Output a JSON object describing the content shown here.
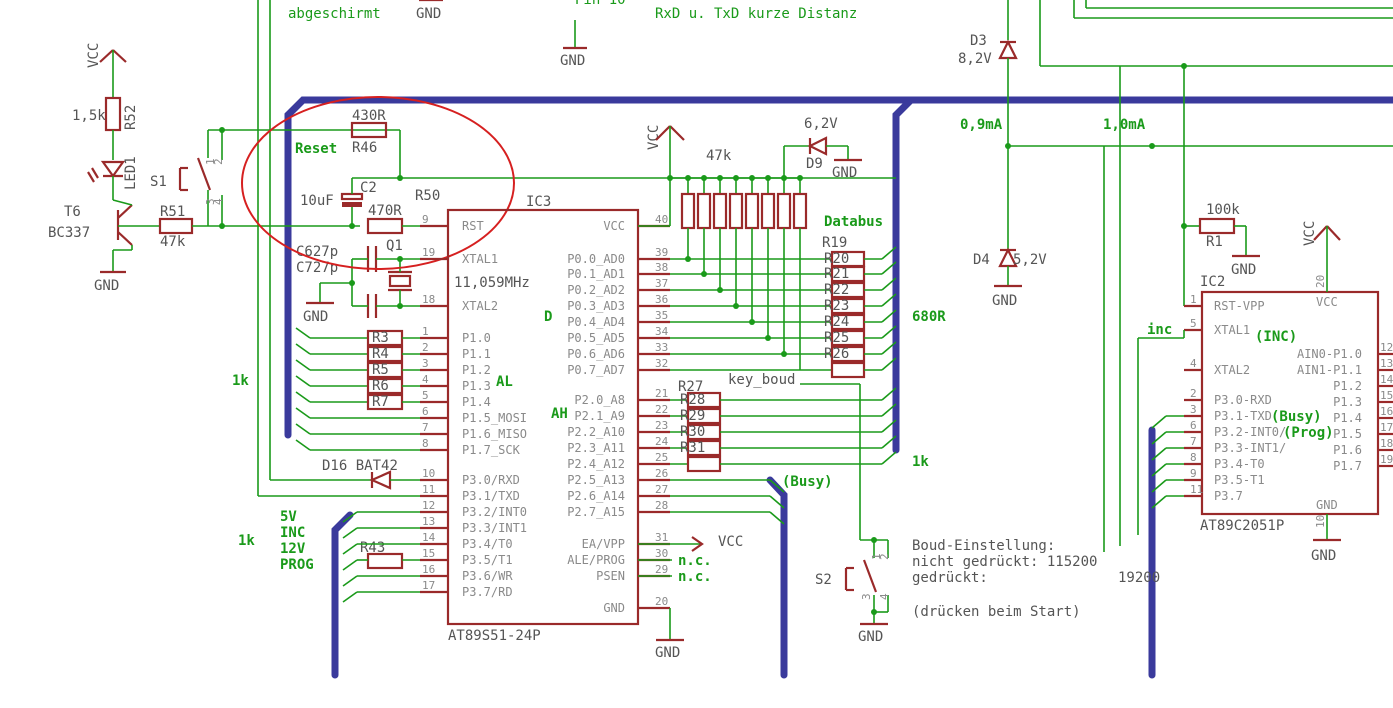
{
  "title_notes": {
    "shielded": "abgeschirmt",
    "rxd_txd": "RxD u. TxD kurze Distanz",
    "pin_top": "Pin 10"
  },
  "power": {
    "vcc": "VCC",
    "gnd": "GND"
  },
  "left_section": {
    "r52_value": "1,5k",
    "r52_name": "R52",
    "led1": "LED1",
    "t6": "T6",
    "bc337": "BC337",
    "r51": "R51",
    "r51_value": "47k",
    "s1": "S1",
    "reset": "Reset",
    "r46": "R46",
    "r46_value": "430R",
    "c2": "C2",
    "c2_value": "10uF",
    "r50": "R50",
    "r50_value": "470R",
    "c6": "C6",
    "c6_value": "27p",
    "c7": "C7",
    "c7_value": "27p",
    "q1": "Q1",
    "crystal": "11,059MHz",
    "one_k_left": "1k",
    "d16": "D16",
    "bat42": "BAT42",
    "one_k_bottom": "1k",
    "mode_labels": [
      "5V",
      "INC",
      "12V",
      "PROG"
    ],
    "r43": "R43"
  },
  "ic3": {
    "name": "IC3",
    "part": "AT89S51-24P",
    "left_pins": [
      {
        "num": "9",
        "label": "RST"
      },
      {
        "num": "19",
        "label": "XTAL1"
      },
      {
        "num": "18",
        "label": "XTAL2"
      },
      {
        "num": "1",
        "label": "P1.0"
      },
      {
        "num": "2",
        "label": "P1.1"
      },
      {
        "num": "3",
        "label": "P1.2"
      },
      {
        "num": "4",
        "label": "P1.3"
      },
      {
        "num": "5",
        "label": "P1.4"
      },
      {
        "num": "6",
        "label": "P1.5_MOSI"
      },
      {
        "num": "7",
        "label": "P1.6_MISO"
      },
      {
        "num": "8",
        "label": "P1.7_SCK"
      },
      {
        "num": "10",
        "label": "P3.0/RXD"
      },
      {
        "num": "11",
        "label": "P3.1/TXD"
      },
      {
        "num": "12",
        "label": "P3.2/INT0"
      },
      {
        "num": "13",
        "label": "P3.3/INT1"
      },
      {
        "num": "14",
        "label": "P3.4/T0"
      },
      {
        "num": "15",
        "label": "P3.5/T1"
      },
      {
        "num": "16",
        "label": "P3.6/WR"
      },
      {
        "num": "17",
        "label": "P3.7/RD"
      }
    ],
    "right_pins": [
      {
        "num": "40",
        "label": "VCC"
      },
      {
        "num": "39",
        "label": "P0.0_AD0"
      },
      {
        "num": "38",
        "label": "P0.1_AD1"
      },
      {
        "num": "37",
        "label": "P0.2_AD2"
      },
      {
        "num": "36",
        "label": "P0.3_AD3"
      },
      {
        "num": "35",
        "label": "P0.4_AD4"
      },
      {
        "num": "34",
        "label": "P0.5_AD5"
      },
      {
        "num": "33",
        "label": "P0.6_AD6"
      },
      {
        "num": "32",
        "label": "P0.7_AD7"
      },
      {
        "num": "21",
        "label": "P2.0_A8"
      },
      {
        "num": "22",
        "label": "P2.1_A9"
      },
      {
        "num": "23",
        "label": "P2.2_A10"
      },
      {
        "num": "24",
        "label": "P2.3_A11"
      },
      {
        "num": "25",
        "label": "P2.4_A12"
      },
      {
        "num": "26",
        "label": "P2.5_A13"
      },
      {
        "num": "27",
        "label": "P2.6_A14"
      },
      {
        "num": "28",
        "label": "P2.7_A15"
      },
      {
        "num": "31",
        "label": "EA/VPP"
      },
      {
        "num": "30",
        "label": "ALE/PROG"
      },
      {
        "num": "29",
        "label": "PSEN"
      },
      {
        "num": "20",
        "label": "GND"
      }
    ],
    "al": "AL",
    "ah": "AH",
    "d": "D"
  },
  "resistors_left": [
    "R3",
    "R4",
    "R5",
    "R6",
    "R7"
  ],
  "middle": {
    "rpack_value": "47k",
    "d9": "D9",
    "d9_value": "6,2V",
    "databus": "Databus",
    "r19": "R19",
    "data_resistors": [
      "R20",
      "R21",
      "R22",
      "R23",
      "R24",
      "R25",
      "R26"
    ],
    "ohm_680": "680R",
    "key_boud": "key_boud",
    "r27": "R27",
    "addr_resistors": [
      "R28",
      "R29",
      "R30",
      "R31"
    ],
    "one_k_right": "1k",
    "busy": "(Busy)",
    "nc1": "n.c.",
    "nc2": "n.c."
  },
  "boud": {
    "s2": "S2",
    "line1": "Boud-Einstellung:",
    "line2": "nicht gedrückt: 115200",
    "line3": "gedrückt:",
    "line3_value": "19200",
    "line4": "(drücken beim Start)"
  },
  "right_section": {
    "d3": "D3",
    "d3_value": "8,2V",
    "d4": "D4",
    "d4_value": "5,2V",
    "current1": "0,9mA",
    "current2": "1,0mA",
    "r1_value": "100k",
    "r1": "R1",
    "inc": "inc"
  },
  "ic2": {
    "name": "IC2",
    "part": "AT89C2051P",
    "left_pins": [
      {
        "num": "1",
        "label": "RST-VPP"
      },
      {
        "num": "5",
        "label": "XTAL1"
      },
      {
        "num": "4",
        "label": "XTAL2"
      },
      {
        "num": "2",
        "label": "P3.0-RXD"
      },
      {
        "num": "3",
        "label": "P3.1-TXD"
      },
      {
        "num": "6",
        "label": "P3.2-INT0/"
      },
      {
        "num": "7",
        "label": "P3.3-INT1/"
      },
      {
        "num": "8",
        "label": "P3.4-T0"
      },
      {
        "num": "9",
        "label": "P3.5-T1"
      },
      {
        "num": "11",
        "label": "P3.7"
      }
    ],
    "right_pins": [
      {
        "num": "12",
        "label": "AIN0-P1.0"
      },
      {
        "num": "13",
        "label": "AIN1-P1.1"
      },
      {
        "num": "14",
        "label": "P1.2"
      },
      {
        "num": "15",
        "label": "P1.3"
      },
      {
        "num": "16",
        "label": "P1.4"
      },
      {
        "num": "17",
        "label": "P1.5"
      },
      {
        "num": "18",
        "label": "P1.6"
      },
      {
        "num": "19",
        "label": "P1.7"
      }
    ],
    "vcc_pin": "20",
    "gnd_pin": "10",
    "inc_note": "(INC)",
    "busy_note": "(Busy)",
    "prog_note": "(Prog)"
  },
  "colors": {
    "wire": "#1a9a1a",
    "bus": "#3a3a9c",
    "component": "#9a2a2a",
    "highlight": "#d62020",
    "pin_text": "#8a8a8a"
  }
}
